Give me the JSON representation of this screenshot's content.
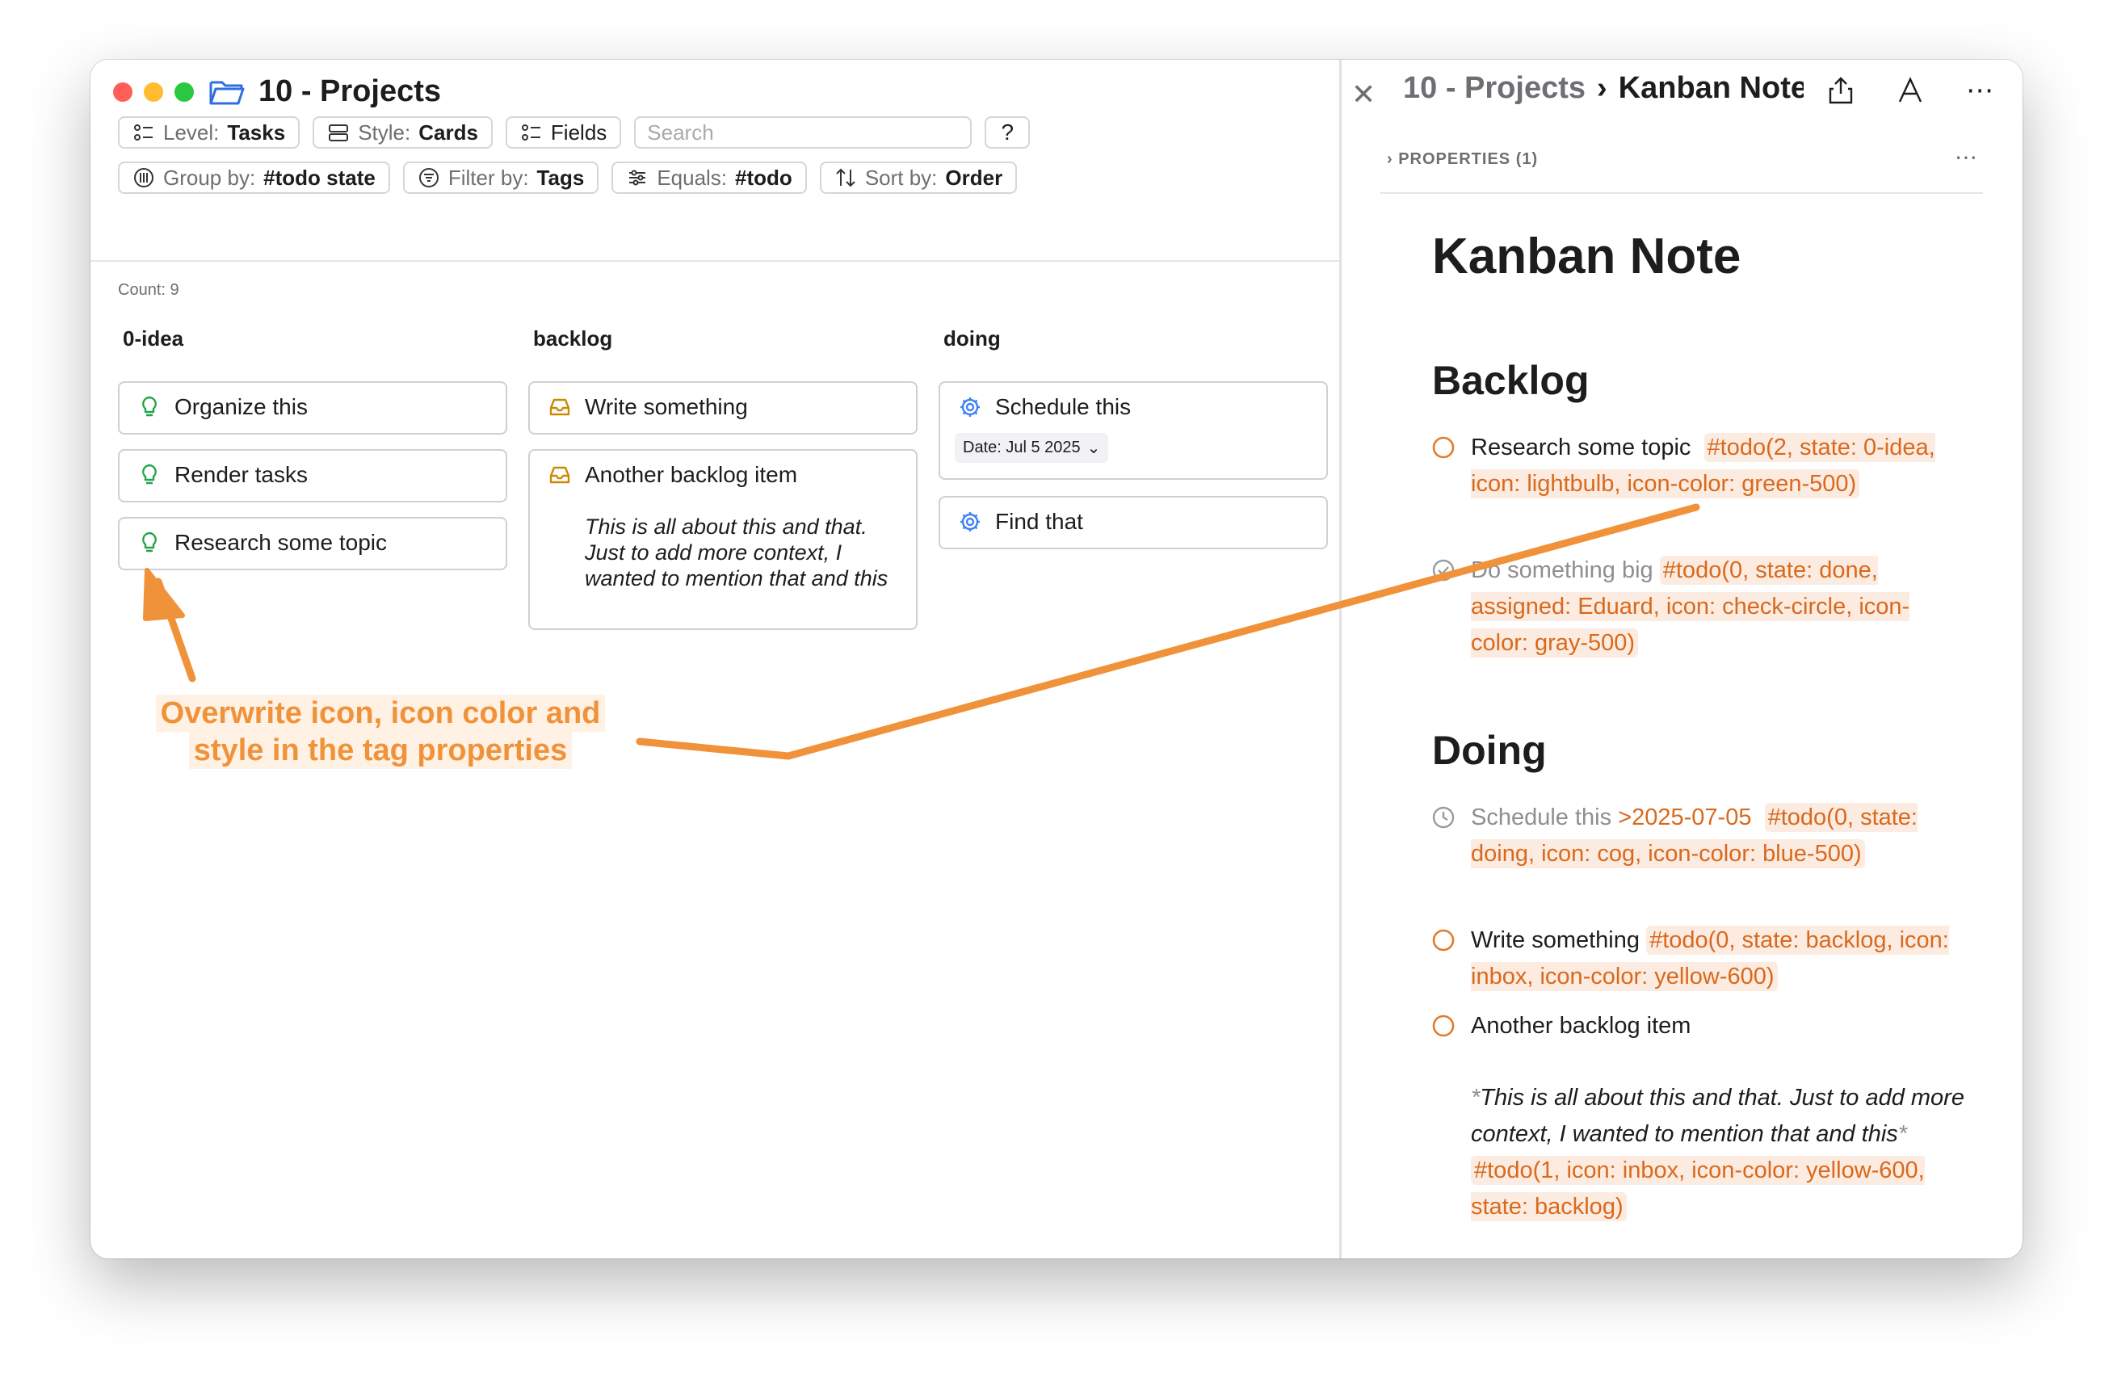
{
  "window": {
    "title": "10 - Projects"
  },
  "toolbar": {
    "row1": [
      {
        "key": "Level:",
        "value": "Tasks",
        "icon": "list-icon"
      },
      {
        "key": "Style:",
        "value": "Cards",
        "icon": "rows-icon"
      },
      {
        "key": "",
        "value": "Fields",
        "icon": "list-icon"
      }
    ],
    "search_placeholder": "Search",
    "help": "?",
    "row2": [
      {
        "key": "Group by:",
        "value": "#todo state",
        "icon": "grid-circle-icon"
      },
      {
        "key": "Filter by:",
        "value": "Tags",
        "icon": "filter-icon"
      },
      {
        "key": "Equals:",
        "value": "#todo",
        "icon": "sliders-icon"
      },
      {
        "key": "Sort by:",
        "value": "Order",
        "icon": "sort-arrows-icon"
      }
    ]
  },
  "board": {
    "count": "Count: 9",
    "columns": [
      {
        "title": "0-idea",
        "cards": [
          "Organize this",
          "Render tasks",
          "Research some topic"
        ]
      },
      {
        "title": "backlog",
        "cards": [
          "Write something",
          "Another backlog item"
        ],
        "card2_body": "This is all about this and that. Just to add more context, I wanted to mention that and this"
      },
      {
        "title": "doing",
        "cards": [
          "Schedule this",
          "Find that"
        ],
        "date_chip": "Date: Jul 5 2025"
      }
    ]
  },
  "annotation": {
    "line1": "Overwrite icon, icon color and",
    "line2": "style in the tag properties"
  },
  "note": {
    "crumb_parent": "10 - Projects",
    "crumb_current": "Kanban Note",
    "properties": "PROPERTIES (1)",
    "title": "Kanban Note",
    "sections": {
      "backlog": "Backlog",
      "doing": "Doing"
    },
    "items": {
      "t1_text": "Research some topic",
      "t1_tag": "#todo(2, state: 0-idea, icon: lightbulb, icon-color: green-500)",
      "t2_text": "Do something big",
      "t2_tag": "#todo(0, state: done, assigned: Eduard, icon: check-circle, icon-color: gray-500)",
      "t3_text": "Schedule this",
      "t3_date": ">2025-07-05",
      "t3_tag": "#todo(0, state: doing, icon: cog, icon-color: blue-500)",
      "t4_text": "Write something",
      "t4_tag": "#todo(0, state: backlog, icon: inbox, icon-color: yellow-600)",
      "t5_text": "Another backlog item",
      "t5_body": "This is all about this and that. Just to add more context, I wanted to mention that and this",
      "t5_tag": "#todo(1, icon: inbox, icon-color: yellow-600, state: backlog)"
    }
  },
  "colors": {
    "accent": "#f0923a",
    "green": "#22a34a",
    "yellow": "#ca8a04",
    "blue": "#3b82f6",
    "tag": "#d9691c"
  }
}
